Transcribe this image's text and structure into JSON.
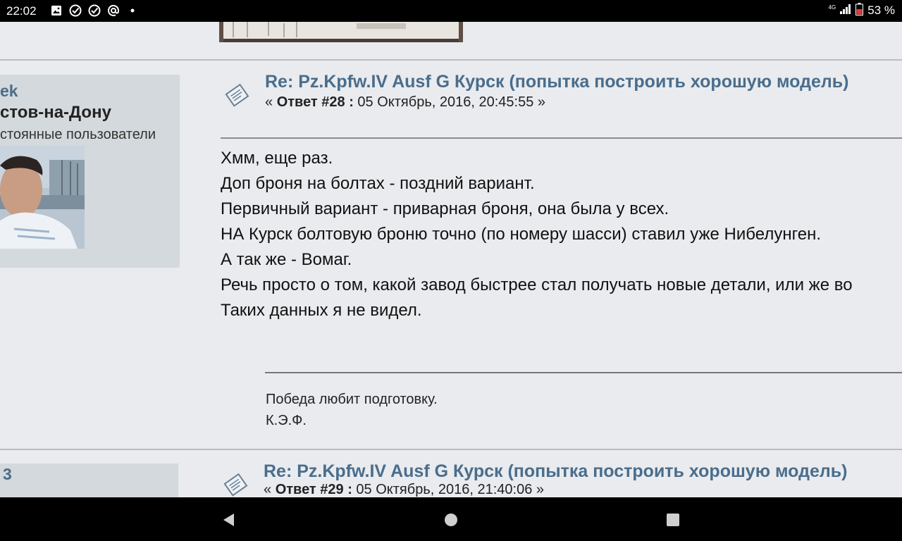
{
  "status_bar": {
    "time": "22:02",
    "network": "4G",
    "battery": "53 %",
    "notification_icons": [
      "image-icon",
      "check-circle-icon",
      "check-circle-icon",
      "at-icon",
      "dot-icon"
    ]
  },
  "post1": {
    "poster": {
      "name": "ek",
      "city": "стов-на-Дону",
      "group": "стоянные пользователи"
    },
    "title": "Re: Pz.Kpfw.IV Ausf G Курск (попытка построить хорошую модель)",
    "meta_prefix": "« ",
    "reply_label": "Ответ #28 :",
    "date": " 05 Октябрь, 2016, 20:45:55 »",
    "body_lines": [
      "Хмм, еще раз.",
      "Доп броня на болтах - поздний вариант.",
      "Первичный вариант - приварная броня, она была у всех.",
      "НА Курск болтовую броню точно (по номеру шасси) ставил уже Нибелунген.",
      "А так же - Вомаг.",
      "Речь просто о том, какой завод быстрее стал получать новые детали, или же во",
      "Таких данных я не видел."
    ],
    "signature": [
      "Победа любит подготовку.",
      "К.Э.Ф."
    ]
  },
  "post2": {
    "poster": {
      "name": "3"
    },
    "title": "Re: Pz.Kpfw.IV Ausf G Курск (попытка построить хорошую модель)",
    "meta_prefix": "« ",
    "reply_label": "Ответ #29 :",
    "date": " 05 Октябрь, 2016, 21:40:06 »"
  },
  "nav": {
    "buttons": [
      "back-icon",
      "home-icon",
      "recents-icon"
    ]
  },
  "colors": {
    "page_bg": "#e9ebee",
    "poster_panel": "#d3d9dc",
    "link": "#4a6d8c"
  }
}
